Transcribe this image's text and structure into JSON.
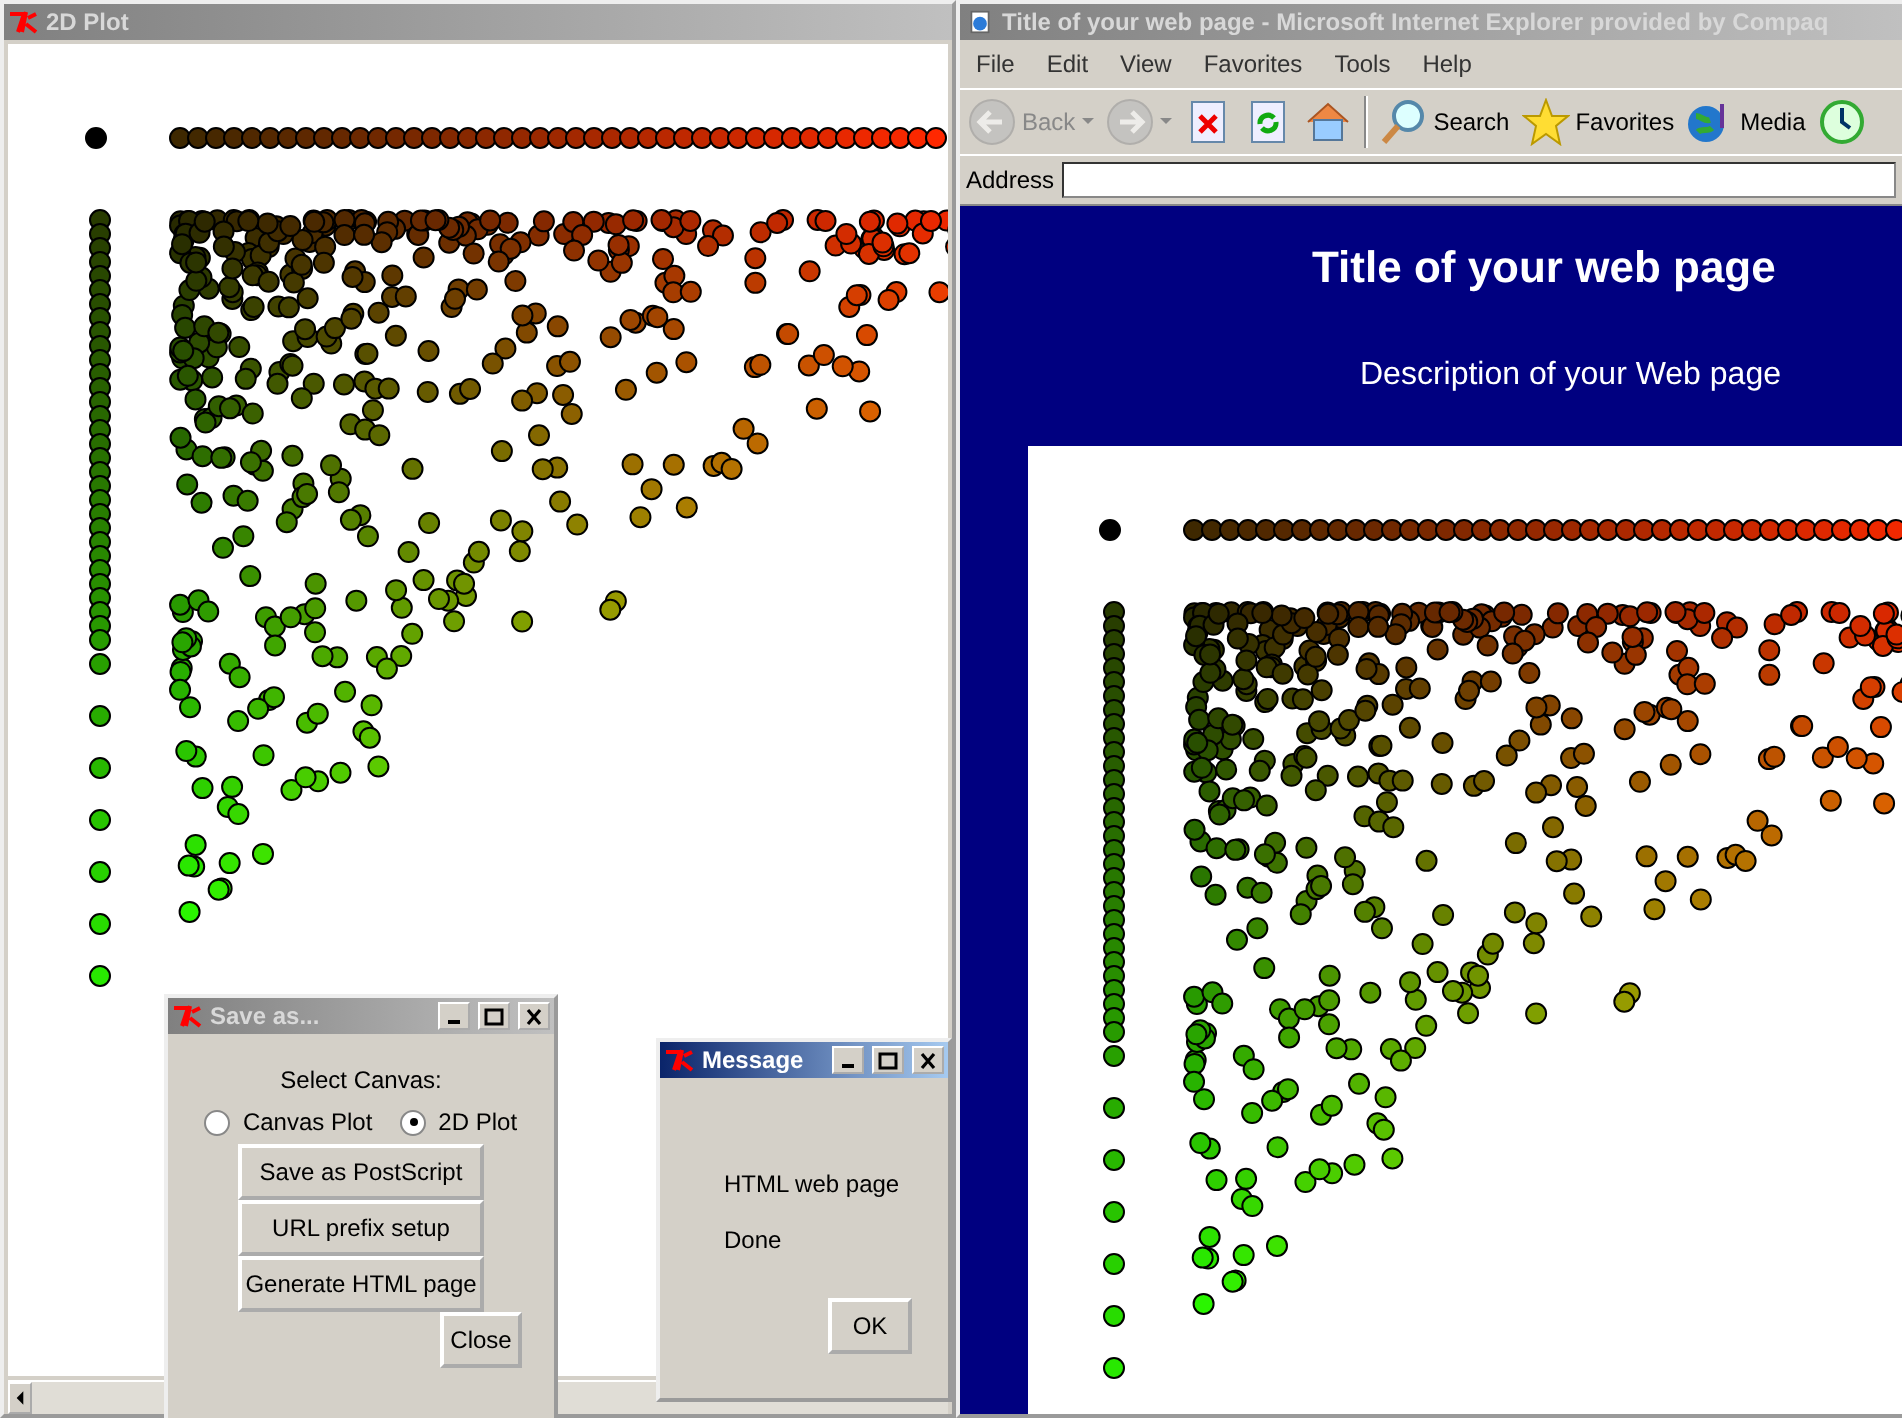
{
  "plot_window": {
    "title": "2D Plot",
    "active": false
  },
  "browser": {
    "title": "Title of your web page - Microsoft Internet Explorer provided by Compaq",
    "active": false,
    "menu": [
      "File",
      "Edit",
      "View",
      "Favorites",
      "Tools",
      "Help"
    ],
    "toolbar": [
      {
        "kind": "back",
        "label": "Back",
        "disabled": true
      },
      {
        "kind": "forward",
        "disabled": true
      },
      {
        "kind": "stop",
        "disabled": false
      },
      {
        "kind": "refresh",
        "disabled": false
      },
      {
        "kind": "home",
        "disabled": false
      },
      {
        "kind": "search",
        "label": "Search",
        "disabled": false
      },
      {
        "kind": "favorites",
        "label": "Favorites",
        "disabled": false
      },
      {
        "kind": "media",
        "label": "Media",
        "disabled": false
      },
      {
        "kind": "history",
        "disabled": false
      }
    ],
    "address_label": "Address",
    "page": {
      "heading": "Title of your web page",
      "description": "Description of your Web page"
    }
  },
  "save_dialog": {
    "title": "Save as...",
    "active": false,
    "prompt": "Select Canvas:",
    "options": [
      {
        "label": "Canvas Plot",
        "selected": false
      },
      {
        "label": "2D Plot",
        "selected": true
      }
    ],
    "buttons": [
      "Save as PostScript",
      "URL prefix setup",
      "Generate HTML page"
    ],
    "close": "Close"
  },
  "message_dialog": {
    "title": "Message",
    "active": true,
    "lines": [
      "HTML web page",
      "Done"
    ],
    "button": "OK"
  }
}
